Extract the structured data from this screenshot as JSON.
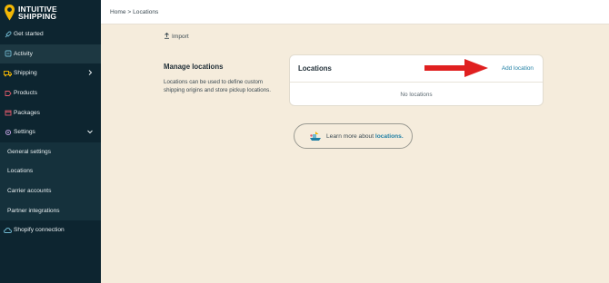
{
  "brand": {
    "line1": "INTUITIVE",
    "line2": "SHIPPING",
    "pin_color": "#f2b705"
  },
  "breadcrumb": "Home > Locations",
  "sidebar": {
    "items": [
      {
        "label": "Get started",
        "icon": "rocket-icon"
      },
      {
        "label": "Activity",
        "icon": "activity-icon",
        "active": true
      },
      {
        "label": "Shipping",
        "icon": "truck-icon",
        "chevron": "right"
      },
      {
        "label": "Products",
        "icon": "tag-icon"
      },
      {
        "label": "Packages",
        "icon": "box-icon"
      },
      {
        "label": "Settings",
        "icon": "gear-icon",
        "chevron": "down"
      }
    ],
    "sub_items": [
      {
        "label": "General settings"
      },
      {
        "label": "Locations"
      },
      {
        "label": "Carrier accounts"
      },
      {
        "label": "Partner integrations"
      }
    ],
    "footer_item": {
      "label": "Shopify connection",
      "icon": "cloud-icon"
    }
  },
  "import_label": "Import",
  "manage": {
    "title": "Manage locations",
    "description": "Locations can be used to define custom shipping origins and store pickup locations."
  },
  "locations_card": {
    "title": "Locations",
    "add_label": "Add location",
    "empty_text": "No locations"
  },
  "learn_more": {
    "prefix": "Learn more about ",
    "link": "locations."
  },
  "colors": {
    "sidebar": "#0d2530",
    "accent": "#1f7fa4",
    "arrow": "#e02020",
    "background": "#f5ecdc"
  }
}
